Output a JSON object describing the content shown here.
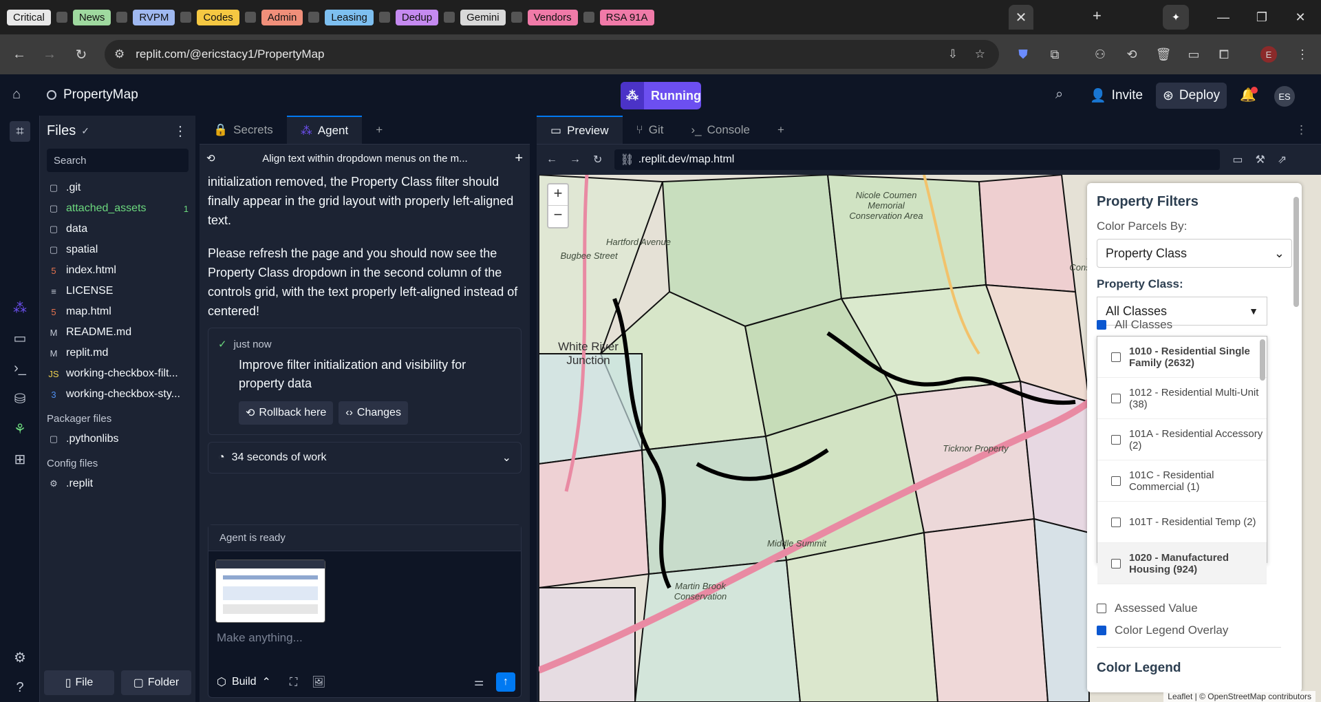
{
  "browser": {
    "tab_labels": [
      {
        "text": "Critical",
        "bg": "#e8e8e8"
      },
      {
        "text": "News",
        "bg": "#9fd99f"
      },
      {
        "text": "RVPM",
        "bg": "#9fb8f0"
      },
      {
        "text": "Codes",
        "bg": "#f5c842"
      },
      {
        "text": "Admin",
        "bg": "#f08f7a"
      },
      {
        "text": "Leasing",
        "bg": "#7dbff0"
      },
      {
        "text": "Dedup",
        "bg": "#c58af0"
      },
      {
        "text": "Gemini",
        "bg": "#d9d9d9"
      },
      {
        "text": "Vendors",
        "bg": "#f07aa8"
      },
      {
        "text": "RSA 91A",
        "bg": "#f07aa8"
      }
    ],
    "url_host": "replit.com/@ericstacy1/PropertyMap",
    "profile_initial": "E"
  },
  "replit": {
    "project_name": "PropertyMap",
    "run_status": "Running",
    "invite_label": "Invite",
    "deploy_label": "Deploy",
    "user_initials": "ES"
  },
  "files": {
    "title": "Files",
    "search_placeholder": "Search",
    "items": [
      {
        "name": ".git",
        "icon": "folder",
        "color": "#f5f9fc"
      },
      {
        "name": "attached_assets",
        "icon": "folder",
        "color": "#6cd97e",
        "badge": "1"
      },
      {
        "name": "data",
        "icon": "folder",
        "color": "#f5f9fc"
      },
      {
        "name": "spatial",
        "icon": "folder",
        "color": "#f5f9fc"
      },
      {
        "name": "index.html",
        "icon": "html",
        "color": "#f5f9fc"
      },
      {
        "name": "LICENSE",
        "icon": "file",
        "color": "#f5f9fc"
      },
      {
        "name": "map.html",
        "icon": "html",
        "color": "#f5f9fc"
      },
      {
        "name": "README.md",
        "icon": "md",
        "color": "#f5f9fc"
      },
      {
        "name": "replit.md",
        "icon": "md",
        "color": "#f5f9fc"
      },
      {
        "name": "working-checkbox-filt...",
        "icon": "js",
        "color": "#f5f9fc"
      },
      {
        "name": "working-checkbox-sty...",
        "icon": "css",
        "color": "#f5f9fc"
      }
    ],
    "packager_label": "Packager files",
    "packager_items": [
      ".pythonlibs"
    ],
    "config_label": "Config files",
    "config_items": [
      ".replit"
    ],
    "new_file_label": "File",
    "new_folder_label": "Folder"
  },
  "agent": {
    "tabs": [
      "Secrets",
      "Agent"
    ],
    "thread_title": "Align text within dropdown menus on the m...",
    "message_p1": "initialization removed, the Property Class filter should finally appear in the grid layout with properly left-aligned text.",
    "message_p2": "Please refresh the page and you should now see the Property Class dropdown in the second column of the controls grid, with the text properly left-aligned instead of centered!",
    "checkpoint_time": "just now",
    "checkpoint_title": "Improve filter initialization and visibility for property data",
    "rollback_label": "Rollback here",
    "changes_label": "Changes",
    "work_summary": "34 seconds of work",
    "status": "Agent is ready",
    "input_placeholder": "Make anything...",
    "build_label": "Build"
  },
  "preview": {
    "tabs": [
      "Preview",
      "Git",
      "Console"
    ],
    "url": ".replit.dev/map.html",
    "map_labels": [
      {
        "text": "White River Junction",
        "k": "wrj"
      },
      {
        "text": "Nicole Coumen Memorial Conservation Area",
        "k": "nc"
      },
      {
        "text": "Signal Hill Conservation Area",
        "k": "sh"
      },
      {
        "text": "Ticknor Property",
        "k": "tp"
      },
      {
        "text": "Middle Summit",
        "k": "ms"
      },
      {
        "text": "Martin Brook Conservation",
        "k": "mb"
      },
      {
        "text": "Bugbee Street",
        "k": "bs"
      },
      {
        "text": "Hartford Avenue",
        "k": "ha"
      }
    ],
    "attribution": "Leaflet | © OpenStreetMap contributors"
  },
  "filters": {
    "title": "Property Filters",
    "color_by_label": "Color Parcels By:",
    "color_by_value": "Property Class",
    "property_class_label": "Property Class:",
    "property_class_value": "All Classes",
    "all_classes": "All Classes",
    "options": [
      "1010 - Residential Single Family (2632)",
      "1012 - Residential Multi-Unit (38)",
      "101A - Residential Accessory (2)",
      "101C - Residential Commercial (1)",
      "101T - Residential Temp (2)",
      "1020 - Manufactured Housing (924)"
    ],
    "assessed_value": "Assessed Value",
    "legend_overlay": "Color Legend Overlay",
    "color_legend": "Color Legend"
  }
}
